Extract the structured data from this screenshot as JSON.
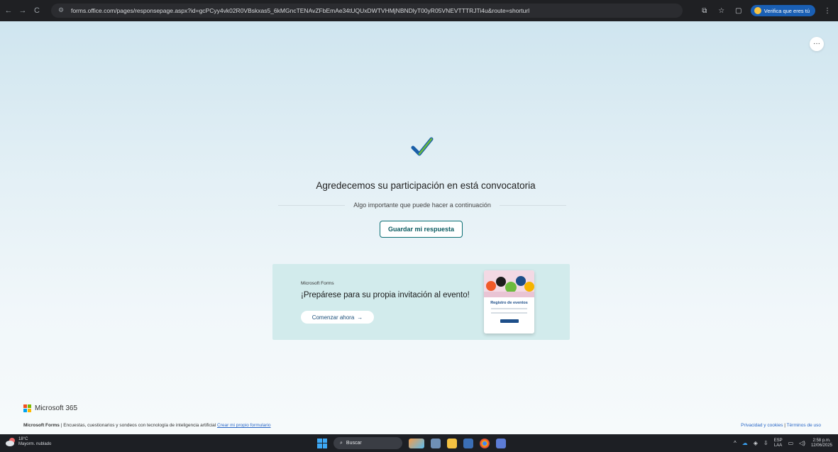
{
  "browser": {
    "url": "forms.office.com/pages/responsepage.aspx?id=gcPCyy4vk02R0VBskxas5_6kMGncTENAvZFbEmAe34tUQUxDWTVHMjNBNDlyT00yR05VNEVTTTRJTi4u&route=shorturl",
    "profile_label": "Verifica que eres tú",
    "icons": [
      "back-arrow-icon",
      "forward-arrow-icon",
      "reload-icon",
      "site-info-icon",
      "install-icon",
      "star-icon",
      "extensions-icon",
      "menu-icon"
    ]
  },
  "page": {
    "more_label": "···",
    "thanks_text": "Agredecemos su participación en está convocatoria",
    "next_steps_text": "Algo importante que puede hacer a continuación",
    "save_button": "Guardar mi respuesta",
    "promo": {
      "brand": "Microsoft Forms",
      "title": "¡Prepárese para su propia invitación al evento!",
      "cta": "Comenzar ahora",
      "cta_arrow": "→",
      "card_title": "Registro de eventos"
    },
    "footer": {
      "logo_text": "Microsoft 365",
      "brand": "Microsoft Forms",
      "description": " | Encuestas, cuestionarios y sondeos con tecnología de inteligencia artificial ",
      "create_link": "Crear mi propio formulario",
      "privacy": "Privacidad y cookies",
      "separator": " | ",
      "terms": "Términos de uso"
    },
    "colors": {
      "accent": "#0a6e73",
      "link": "#2866c6",
      "promo_bg": "#d2ebec",
      "check_blue": "#1a5fa8",
      "check_green": "#6cbb3c"
    }
  },
  "taskbar": {
    "temperature": "18°C",
    "weather": "Mayorm. nublado",
    "search_label": "Buscar",
    "lang_top": "ESP",
    "lang_bottom": "LAA",
    "time": "2:58 p.m.",
    "date": "12/06/2025"
  }
}
